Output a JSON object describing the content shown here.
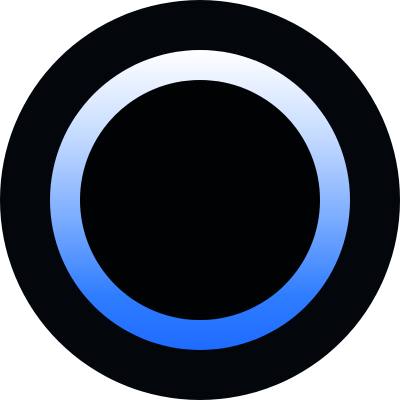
{
  "icon": {
    "name": "cortana-ring-icon",
    "colors": {
      "background": "#03060b",
      "center": "#010203",
      "ring_top": "#ffffff",
      "ring_bottom": "#1f6bff"
    }
  }
}
